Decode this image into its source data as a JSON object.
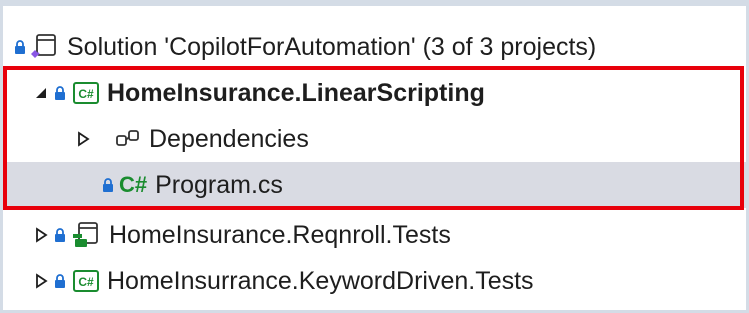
{
  "solution_explorer": {
    "solution_row": {
      "label": "Solution 'CopilotForAutomation' (3 of 3 projects)"
    },
    "project_linear": {
      "label": "HomeInsurance.LinearScripting",
      "icon": "csharp-project-icon"
    },
    "dependencies": {
      "label": "Dependencies",
      "icon": "dependencies-icon"
    },
    "program_file": {
      "label": "Program.cs",
      "icon_text": "C#"
    },
    "project_reqnroll": {
      "label": "HomeInsurance.Reqnroll.Tests",
      "icon": "test-project-icon"
    },
    "project_keyword": {
      "label": "HomeInsurrance.KeywordDriven.Tests",
      "icon": "csharp-project-icon"
    }
  },
  "colors": {
    "lock": "#1f6fd1",
    "csharp_green": "#1a8c2f",
    "selection_bg": "#d9dbe3",
    "highlight_border": "#e8000b"
  }
}
